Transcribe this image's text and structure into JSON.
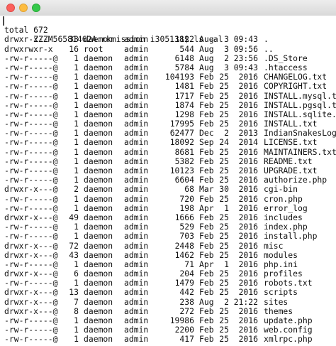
{
  "prompt": "ZZZM56581462A:rkmission i305138$ ls -al",
  "total": "total 672",
  "files": [
    {
      "perm": "drwxr-x---",
      "links": "33",
      "owner": "daemon",
      "group": "admin",
      "size": "1122",
      "month": "Aug",
      "day": "3",
      "time": "09:43",
      "name": "."
    },
    {
      "perm": "drwxrwxr-x",
      "links": "16",
      "owner": "root",
      "group": "admin",
      "size": "544",
      "month": "Aug",
      "day": "3",
      "time": "09:56",
      "name": ".."
    },
    {
      "perm": "-rw-r-----@",
      "links": "1",
      "owner": "daemon",
      "group": "admin",
      "size": "6148",
      "month": "Aug",
      "day": "2",
      "time": "23:56",
      "name": ".DS_Store"
    },
    {
      "perm": "-rw-r-----@",
      "links": "1",
      "owner": "daemon",
      "group": "admin",
      "size": "5784",
      "month": "Aug",
      "day": "3",
      "time": "09:43",
      "name": ".htaccess"
    },
    {
      "perm": "-rw-r-----@",
      "links": "1",
      "owner": "daemon",
      "group": "admin",
      "size": "104193",
      "month": "Feb",
      "day": "25",
      "time": "2016",
      "name": "CHANGELOG.txt"
    },
    {
      "perm": "-rw-r-----@",
      "links": "1",
      "owner": "daemon",
      "group": "admin",
      "size": "1481",
      "month": "Feb",
      "day": "25",
      "time": "2016",
      "name": "COPYRIGHT.txt"
    },
    {
      "perm": "-rw-r-----@",
      "links": "1",
      "owner": "daemon",
      "group": "admin",
      "size": "1717",
      "month": "Feb",
      "day": "25",
      "time": "2016",
      "name": "INSTALL.mysql.txt"
    },
    {
      "perm": "-rw-r-----@",
      "links": "1",
      "owner": "daemon",
      "group": "admin",
      "size": "1874",
      "month": "Feb",
      "day": "25",
      "time": "2016",
      "name": "INSTALL.pgsql.txt"
    },
    {
      "perm": "-rw-r-----@",
      "links": "1",
      "owner": "daemon",
      "group": "admin",
      "size": "1298",
      "month": "Feb",
      "day": "25",
      "time": "2016",
      "name": "INSTALL.sqlite.txt"
    },
    {
      "perm": "-rw-r-----@",
      "links": "1",
      "owner": "daemon",
      "group": "admin",
      "size": "17995",
      "month": "Feb",
      "day": "25",
      "time": "2016",
      "name": "INSTALL.txt"
    },
    {
      "perm": "-rw-r-----@",
      "links": "1",
      "owner": "daemon",
      "group": "admin",
      "size": "62477",
      "month": "Dec",
      "day": "2",
      "time": "2013",
      "name": "IndianSnakesLogo.png"
    },
    {
      "perm": "-rw-r-----@",
      "links": "1",
      "owner": "daemon",
      "group": "admin",
      "size": "18092",
      "month": "Sep",
      "day": "24",
      "time": "2014",
      "name": "LICENSE.txt"
    },
    {
      "perm": "-rw-r-----@",
      "links": "1",
      "owner": "daemon",
      "group": "admin",
      "size": "8681",
      "month": "Feb",
      "day": "25",
      "time": "2016",
      "name": "MAINTAINERS.txt"
    },
    {
      "perm": "-rw-r-----@",
      "links": "1",
      "owner": "daemon",
      "group": "admin",
      "size": "5382",
      "month": "Feb",
      "day": "25",
      "time": "2016",
      "name": "README.txt"
    },
    {
      "perm": "-rw-r-----@",
      "links": "1",
      "owner": "daemon",
      "group": "admin",
      "size": "10123",
      "month": "Feb",
      "day": "25",
      "time": "2016",
      "name": "UPGRADE.txt"
    },
    {
      "perm": "-rw-r-----@",
      "links": "1",
      "owner": "daemon",
      "group": "admin",
      "size": "6604",
      "month": "Feb",
      "day": "25",
      "time": "2016",
      "name": "authorize.php"
    },
    {
      "perm": "drwxr-x---@",
      "links": "2",
      "owner": "daemon",
      "group": "admin",
      "size": "68",
      "month": "Mar",
      "day": "30",
      "time": "2016",
      "name": "cgi-bin"
    },
    {
      "perm": "-rw-r-----@",
      "links": "1",
      "owner": "daemon",
      "group": "admin",
      "size": "720",
      "month": "Feb",
      "day": "25",
      "time": "2016",
      "name": "cron.php"
    },
    {
      "perm": "-rw-r-----@",
      "links": "1",
      "owner": "daemon",
      "group": "admin",
      "size": "198",
      "month": "Apr",
      "day": "1",
      "time": "2016",
      "name": "error_log"
    },
    {
      "perm": "drwxr-x---@",
      "links": "49",
      "owner": "daemon",
      "group": "admin",
      "size": "1666",
      "month": "Feb",
      "day": "25",
      "time": "2016",
      "name": "includes"
    },
    {
      "perm": "-rw-r-----@",
      "links": "1",
      "owner": "daemon",
      "group": "admin",
      "size": "529",
      "month": "Feb",
      "day": "25",
      "time": "2016",
      "name": "index.php"
    },
    {
      "perm": "-rw-r-----@",
      "links": "1",
      "owner": "daemon",
      "group": "admin",
      "size": "703",
      "month": "Feb",
      "day": "25",
      "time": "2016",
      "name": "install.php"
    },
    {
      "perm": "drwxr-x---@",
      "links": "72",
      "owner": "daemon",
      "group": "admin",
      "size": "2448",
      "month": "Feb",
      "day": "25",
      "time": "2016",
      "name": "misc"
    },
    {
      "perm": "drwxr-x---@",
      "links": "43",
      "owner": "daemon",
      "group": "admin",
      "size": "1462",
      "month": "Feb",
      "day": "25",
      "time": "2016",
      "name": "modules"
    },
    {
      "perm": "-rw-r-----@",
      "links": "1",
      "owner": "daemon",
      "group": "admin",
      "size": "71",
      "month": "Apr",
      "day": "1",
      "time": "2016",
      "name": "php.ini"
    },
    {
      "perm": "drwxr-x---@",
      "links": "6",
      "owner": "daemon",
      "group": "admin",
      "size": "204",
      "month": "Feb",
      "day": "25",
      "time": "2016",
      "name": "profiles"
    },
    {
      "perm": "-rw-r-----@",
      "links": "1",
      "owner": "daemon",
      "group": "admin",
      "size": "1479",
      "month": "Feb",
      "day": "25",
      "time": "2016",
      "name": "robots.txt"
    },
    {
      "perm": "drwxr-x---@",
      "links": "13",
      "owner": "daemon",
      "group": "admin",
      "size": "442",
      "month": "Feb",
      "day": "25",
      "time": "2016",
      "name": "scripts"
    },
    {
      "perm": "drwxr-x---@",
      "links": "7",
      "owner": "daemon",
      "group": "admin",
      "size": "238",
      "month": "Aug",
      "day": "2",
      "time": "21:22",
      "name": "sites"
    },
    {
      "perm": "drwxr-x---@",
      "links": "8",
      "owner": "daemon",
      "group": "admin",
      "size": "272",
      "month": "Feb",
      "day": "25",
      "time": "2016",
      "name": "themes"
    },
    {
      "perm": "-rw-r-----@",
      "links": "1",
      "owner": "daemon",
      "group": "admin",
      "size": "19986",
      "month": "Feb",
      "day": "25",
      "time": "2016",
      "name": "update.php"
    },
    {
      "perm": "-rw-r-----@",
      "links": "1",
      "owner": "daemon",
      "group": "admin",
      "size": "2200",
      "month": "Feb",
      "day": "25",
      "time": "2016",
      "name": "web.config"
    },
    {
      "perm": "-rw-r-----@",
      "links": "1",
      "owner": "daemon",
      "group": "admin",
      "size": "417",
      "month": "Feb",
      "day": "25",
      "time": "2016",
      "name": "xmlrpc.php"
    }
  ]
}
